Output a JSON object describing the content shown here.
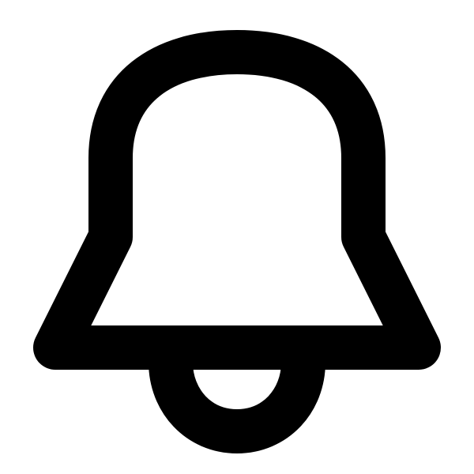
{
  "icon": {
    "name": "bell-icon",
    "stroke_color": "#000000",
    "background_color": "#ffffff"
  }
}
